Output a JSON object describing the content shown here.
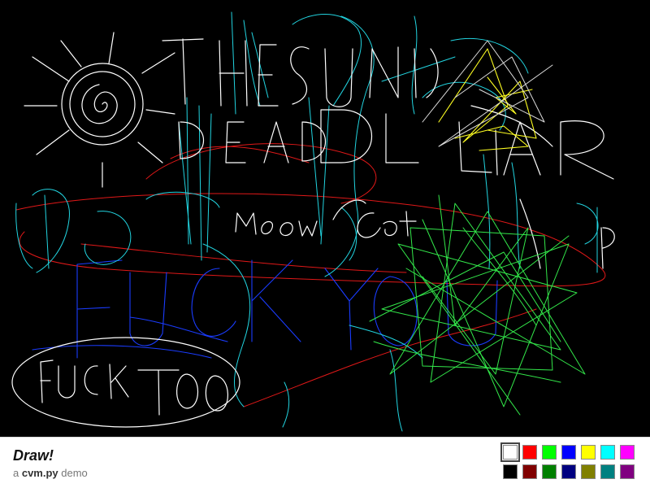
{
  "app": {
    "title": "Draw!",
    "subtitle_prefix": "a ",
    "subtitle_name": "cvm.py",
    "subtitle_suffix": " demo"
  },
  "palette": {
    "selected": "white",
    "row1": [
      {
        "name": "white",
        "color": "#ffffff"
      },
      {
        "name": "red",
        "color": "#ff0000"
      },
      {
        "name": "green",
        "color": "#00ff00"
      },
      {
        "name": "blue",
        "color": "#0000ff"
      },
      {
        "name": "yellow",
        "color": "#ffff00"
      },
      {
        "name": "cyan",
        "color": "#00ffff"
      },
      {
        "name": "magenta",
        "color": "#ff00ff"
      }
    ],
    "row2": [
      {
        "name": "black",
        "color": "#000000"
      },
      {
        "name": "dark-red",
        "color": "#800000"
      },
      {
        "name": "dark-green",
        "color": "#008000"
      },
      {
        "name": "navy",
        "color": "#000080"
      },
      {
        "name": "olive",
        "color": "#808000"
      },
      {
        "name": "teal",
        "color": "#008080"
      },
      {
        "name": "purple",
        "color": "#800080"
      }
    ]
  },
  "canvas": {
    "background": "#000000",
    "handwritten_text": [
      "THE SUN IS",
      "DEAD",
      "LIAR",
      "Meow Cat",
      "FUCK YOU",
      "FUCK TOO"
    ]
  }
}
